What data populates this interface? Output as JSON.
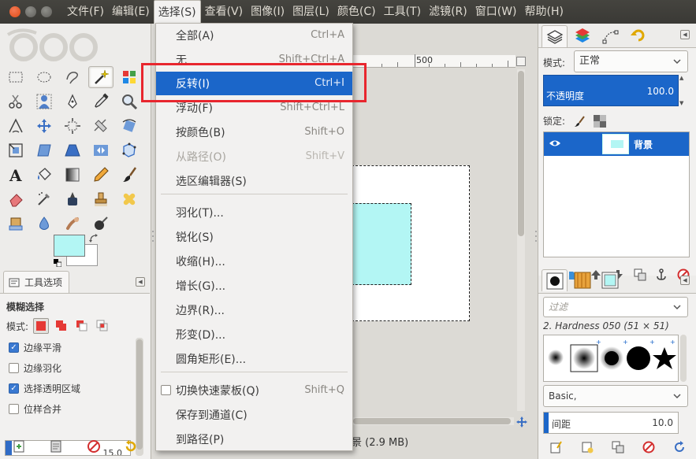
{
  "menubar": {
    "items": [
      "文件(F)",
      "编辑(E)",
      "选择(S)",
      "查看(V)",
      "图像(I)",
      "图层(L)",
      "颜色(C)",
      "工具(T)",
      "滤镜(R)",
      "窗口(W)",
      "帮助(H)"
    ],
    "active_index": 2
  },
  "select_menu": {
    "items": [
      {
        "label": "全部(A)",
        "shortcut": "Ctrl+A",
        "enabled": true
      },
      {
        "label": "无",
        "shortcut": "Shift+Ctrl+A",
        "enabled": true
      },
      {
        "label": "反转(I)",
        "shortcut": "Ctrl+I",
        "enabled": true,
        "highlighted": true
      },
      {
        "label": "浮动(F)",
        "shortcut": "Shift+Ctrl+L",
        "enabled": true
      },
      {
        "label": "按颜色(B)",
        "shortcut": "Shift+O",
        "enabled": true
      },
      {
        "label": "从路径(O)",
        "shortcut": "Shift+V",
        "enabled": false
      },
      {
        "label": "选区编辑器(S)",
        "shortcut": "",
        "enabled": true
      },
      {
        "label": "羽化(T)...",
        "shortcut": "",
        "enabled": true
      },
      {
        "label": "锐化(S)",
        "shortcut": "",
        "enabled": true
      },
      {
        "label": "收缩(H)...",
        "shortcut": "",
        "enabled": true
      },
      {
        "label": "增长(G)...",
        "shortcut": "",
        "enabled": true
      },
      {
        "label": "边界(R)...",
        "shortcut": "",
        "enabled": true
      },
      {
        "label": "形变(D)...",
        "shortcut": "",
        "enabled": true
      },
      {
        "label": "圆角矩形(E)...",
        "shortcut": "",
        "enabled": true
      },
      {
        "label": "切换快速蒙板(Q)",
        "shortcut": "Shift+Q",
        "enabled": true,
        "checkbox": true,
        "checked": false
      },
      {
        "label": "保存到通道(C)",
        "shortcut": "",
        "enabled": true
      },
      {
        "label": "到路径(P)",
        "shortcut": "",
        "enabled": true
      }
    ]
  },
  "toolbox": {
    "colors": {
      "foreground": "#b3f6f4",
      "background": "#ffffff"
    },
    "tool_options_tab": "工具选项",
    "tool_options": {
      "title": "模糊选择",
      "mode_label": "模式:",
      "antialias": {
        "label": "边缘平滑",
        "checked": true
      },
      "feather": {
        "label": "边缘羽化",
        "checked": false
      },
      "select_transparent": {
        "label": "选择透明区域",
        "checked": true
      },
      "sample_merged": {
        "label": "位样合并",
        "checked": false
      },
      "threshold_value": "15.0"
    }
  },
  "canvas": {
    "ruler_label": "500",
    "status_text": "景 (2.9 MB)",
    "image_colors": {
      "background": "#ffffff",
      "shape": "#b3f6f4"
    }
  },
  "layers": {
    "mode_label": "模式:",
    "mode_value": "正常",
    "opacity_label": "不透明度",
    "opacity_value": "100.0",
    "lock_label": "锁定:",
    "items": [
      {
        "name": "背景",
        "visible": true
      }
    ]
  },
  "brushes": {
    "filter_placeholder": "过滤",
    "brush_name": "2. Hardness 050 (51 × 51)",
    "tag": "Basic,",
    "spacing_label": "间距",
    "spacing_value": "10.0"
  }
}
